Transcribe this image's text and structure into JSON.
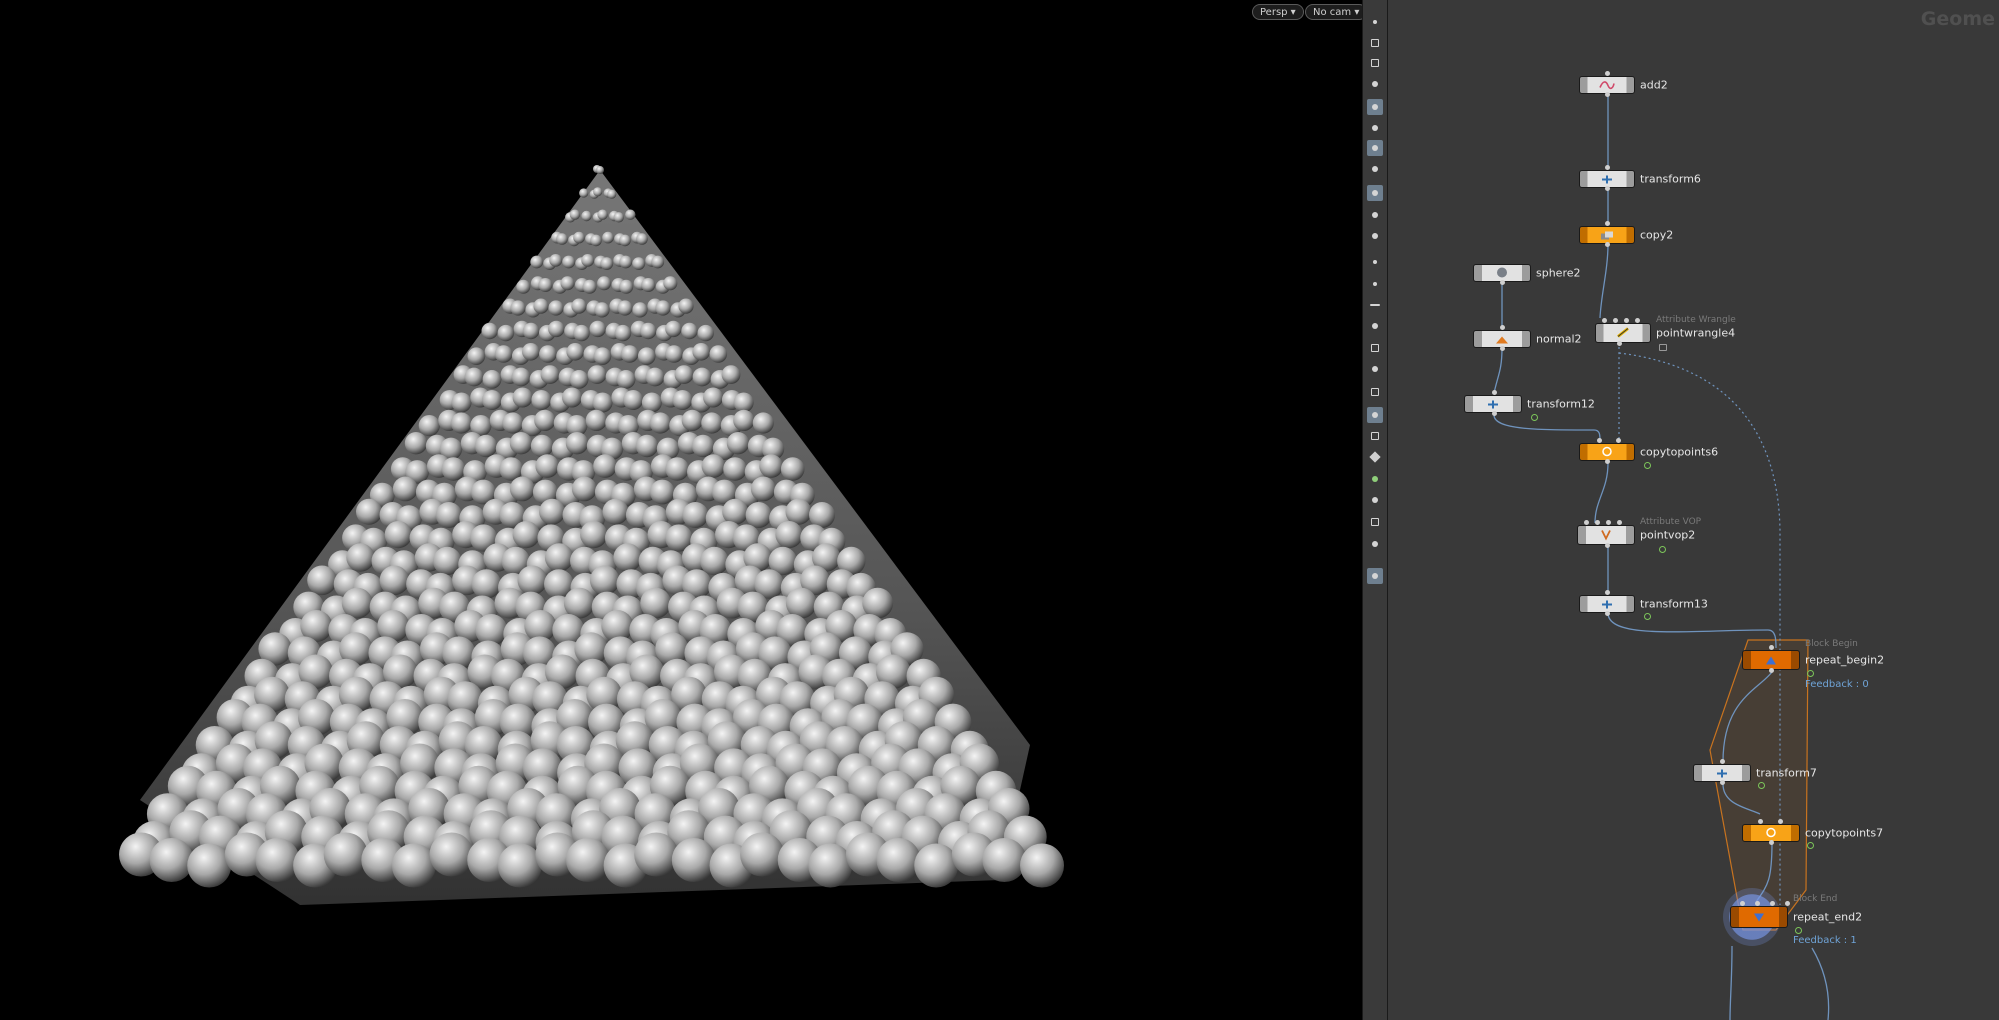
{
  "viewport": {
    "camera_label": "Persp",
    "view_label": "No cam"
  },
  "network": {
    "context_title": "Geome",
    "nodes": [
      {
        "name": "add2"
      },
      {
        "name": "transform6"
      },
      {
        "name": "copy2"
      },
      {
        "name": "sphere2"
      },
      {
        "name": "pointwrangle4",
        "type_label": "Attribute Wrangle"
      },
      {
        "name": "normal2"
      },
      {
        "name": "transform12"
      },
      {
        "name": "copytopoints6"
      },
      {
        "name": "pointvop2",
        "type_label": "Attribute VOP"
      },
      {
        "name": "transform13"
      },
      {
        "name": "repeat_begin2",
        "type_label": "Block Begin",
        "feedback": "Feedback : 0"
      },
      {
        "name": "transform7"
      },
      {
        "name": "copytopoints7"
      },
      {
        "name": "repeat_end2",
        "type_label": "Block End",
        "feedback": "Feedback : 1"
      }
    ]
  },
  "toolbar": {
    "icons": [
      "eye-icon",
      "display-options-icon",
      "lock-icon",
      "snapshot-icon",
      "shading-icon",
      "light-icon",
      "headlight-icon",
      "lamp-icon",
      "camera-icon",
      "visualizer-icon",
      "handles-icon",
      "point-display-icon",
      "prim-display-icon",
      "normal-icon",
      "point-number-icon",
      "uv-icon",
      "wireframe-icon",
      "scene-icon",
      "ortho-icon",
      "grid-icon",
      "bg-icon",
      "geometry-icon",
      "ghost-icon",
      "layout-icon",
      "screenshot-icon",
      "render-icon"
    ]
  }
}
